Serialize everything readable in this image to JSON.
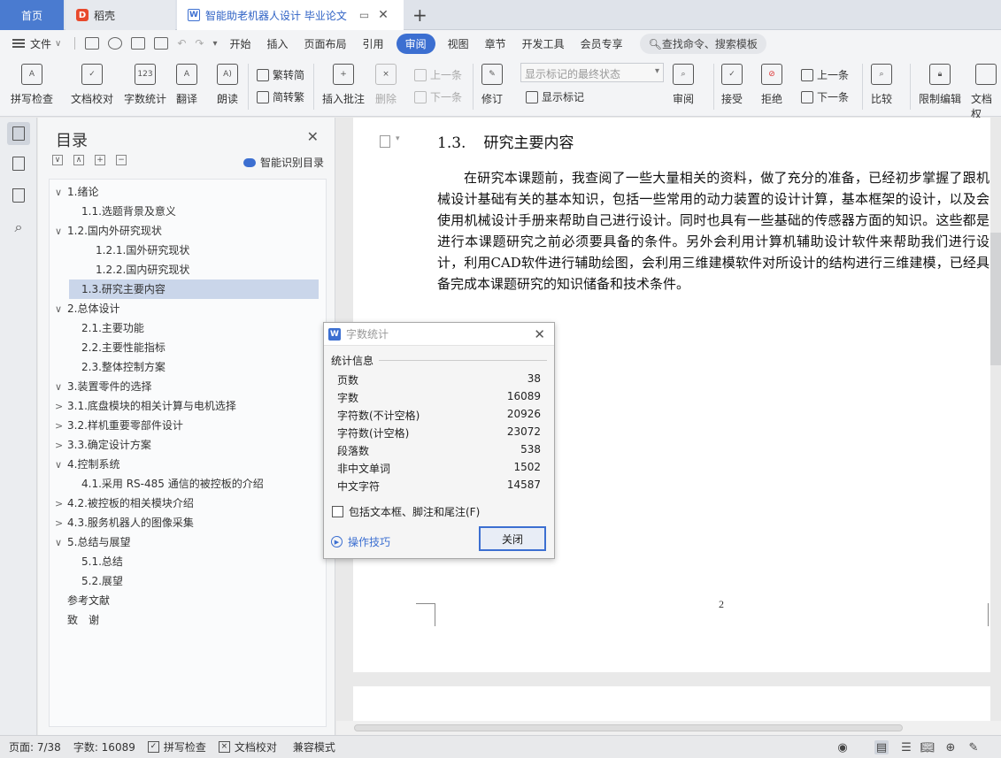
{
  "tabs": {
    "home": "首页",
    "docer": "稻壳",
    "doc_title": "智能助老机器人设计 毕业论文",
    "add": "+"
  },
  "menu": {
    "file": "文件",
    "items": [
      "开始",
      "插入",
      "页面布局",
      "引用",
      "审阅",
      "视图",
      "章节",
      "开发工具",
      "会员专享"
    ],
    "active": "审阅",
    "search": "查找命令、搜索模板"
  },
  "ribbon": {
    "spell_check": "拼写检查",
    "doc_proof": "文档校对",
    "word_count": "字数统计",
    "translate": "翻译",
    "read_aloud": "朗读",
    "trad_simp_to_trad": "繁转简",
    "simp_to_trad": "简转繁",
    "insert_comment": "插入批注",
    "delete": "删除",
    "prev_comment": "上一条",
    "next_comment": "下一条",
    "revise": "修订",
    "markup_select": "显示标记的最终状态",
    "show_markup": "显示标记",
    "review": "审阅",
    "accept": "接受",
    "reject": "拒绝",
    "prev_change": "上一条",
    "next_change": "下一条",
    "compare": "比较",
    "restrict_edit": "限制编辑",
    "doc_rights": "文档权"
  },
  "toc": {
    "title": "目录",
    "smart": "智能识别目录",
    "items": [
      {
        "label": "1.绪论",
        "arrow": "∨"
      },
      {
        "label": "1.1.选题背景及意义",
        "arrow": ""
      },
      {
        "label": "1.2.国内外研究现状",
        "arrow": "∨"
      },
      {
        "label": "1.2.1.国外研究现状",
        "arrow": ""
      },
      {
        "label": "1.2.2.国内研究现状",
        "arrow": ""
      },
      {
        "label": "1.3.研究主要内容",
        "arrow": ""
      },
      {
        "label": "2.总体设计",
        "arrow": "∨"
      },
      {
        "label": "2.1.主要功能",
        "arrow": ""
      },
      {
        "label": "2.2.主要性能指标",
        "arrow": ""
      },
      {
        "label": "2.3.整体控制方案",
        "arrow": ""
      },
      {
        "label": "3.装置零件的选择",
        "arrow": "∨"
      },
      {
        "label": "3.1.底盘模块的相关计算与电机选择",
        "arrow": ">"
      },
      {
        "label": "3.2.样机重要零部件设计",
        "arrow": ">"
      },
      {
        "label": "3.3.确定设计方案",
        "arrow": ">"
      },
      {
        "label": "4.控制系统",
        "arrow": "∨"
      },
      {
        "label": "4.1.采用 RS-485 通信的被控板的介绍",
        "arrow": ""
      },
      {
        "label": "4.2.被控板的相关模块介绍",
        "arrow": ">"
      },
      {
        "label": "4.3.服务机器人的图像采集",
        "arrow": ">"
      },
      {
        "label": "5.总结与展望",
        "arrow": "∨"
      },
      {
        "label": "5.1.总结",
        "arrow": ""
      },
      {
        "label": "5.2.展望",
        "arrow": ""
      },
      {
        "label": "参考文献",
        "arrow": ""
      },
      {
        "label": "致　谢",
        "arrow": ""
      }
    ]
  },
  "document": {
    "heading_num": "1.3.",
    "heading_text": "研究主要内容",
    "paragraph": "在研究本课题前，我查阅了一些大量相关的资料，做了充分的准备，已经初步掌握了跟机械设计基础有关的基本知识，包括一些常用的动力装置的设计计算，基本框架的设计，以及会使用机械设计手册来帮助自己进行设计。同时也具有一些基础的传感器方面的知识。这些都是进行本课题研究之前必须要具备的条件。另外会利用计算机辅助设计软件来帮助我们进行设计，利用CAD软件进行辅助绘图，会利用三维建模软件对所设计的结构进行三维建模，已经具备完成本课题研究的知识储备和技术条件。",
    "page_number": "2"
  },
  "dialog": {
    "title": "字数统计",
    "group": "统计信息",
    "stats": [
      {
        "label": "页数",
        "value": "38"
      },
      {
        "label": "字数",
        "value": "16089"
      },
      {
        "label": "字符数(不计空格)",
        "value": "20926"
      },
      {
        "label": "字符数(计空格)",
        "value": "23072"
      },
      {
        "label": "段落数",
        "value": "538"
      },
      {
        "label": "非中文单词",
        "value": "1502"
      },
      {
        "label": "中文字符",
        "value": "14587"
      }
    ],
    "checkbox": "包括文本框、脚注和尾注(F)",
    "tips": "操作技巧",
    "close": "关闭"
  },
  "status": {
    "page": "页面: 7/38",
    "words": "字数: 16089",
    "spell": "拼写检查",
    "proof": "文档校对",
    "compat": "兼容模式"
  },
  "colors": {
    "accent": "#3c6fd1",
    "home_tab": "#4a7bd0",
    "selected_toc": "#cad6ea"
  }
}
